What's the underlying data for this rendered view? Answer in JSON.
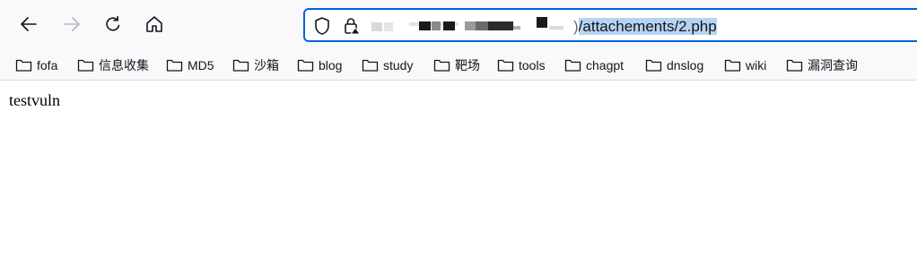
{
  "browser": {
    "url": {
      "visible_prefix": ")",
      "path": "/attachements/2.php"
    },
    "bookmarks": [
      {
        "label": "fofa"
      },
      {
        "label": "信息收集"
      },
      {
        "label": "MD5"
      },
      {
        "label": "沙箱"
      },
      {
        "label": "blog"
      },
      {
        "label": "study"
      },
      {
        "label": "靶场"
      },
      {
        "label": "tools"
      },
      {
        "label": "chagpt"
      },
      {
        "label": "dnslog"
      },
      {
        "label": "wiki"
      },
      {
        "label": "漏洞查询"
      }
    ]
  },
  "page": {
    "body_text": "testvuln"
  },
  "icons": {
    "back": "arrow-left-icon",
    "forward": "arrow-right-icon",
    "reload": "reload-icon",
    "home": "home-icon",
    "shield": "tracking-protection-shield-icon",
    "lock": "insecure-lock-icon",
    "bookmark": "folder-icon"
  },
  "colors": {
    "accent": "#0061e0",
    "selection": "#b5d4f4",
    "toolbar_bg": "#f9f9fb"
  }
}
